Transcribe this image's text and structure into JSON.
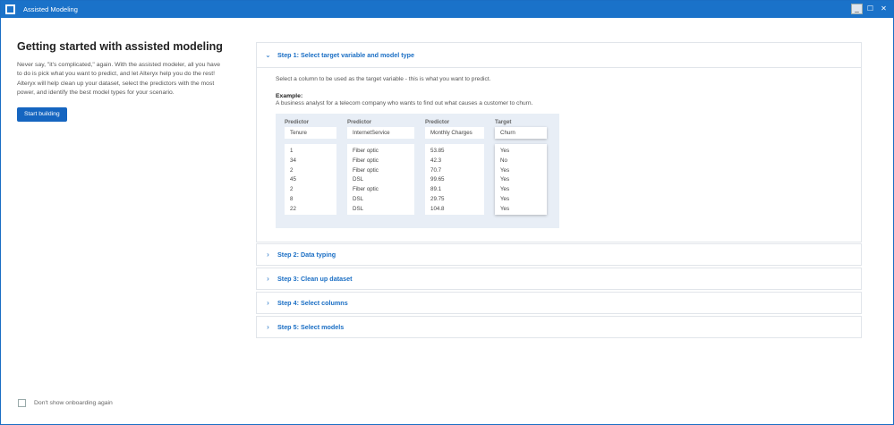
{
  "window": {
    "title": "Assisted Modeling"
  },
  "intro": {
    "heading": "Getting started with assisted modeling",
    "body": "Never say, \"it's complicated,\" again. With the assisted modeler, all you have to do is pick what you want to predict, and let Alteryx help you do the rest! Alteryx will help clean up your dataset, select the predictors with the most power, and identify the best model types for your scenario.",
    "start_button": "Start building"
  },
  "footer": {
    "checkbox_label": "Don't show onboarding again"
  },
  "steps": [
    {
      "title": "Step 1: Select target variable and model type"
    },
    {
      "title": "Step 2: Data typing"
    },
    {
      "title": "Step 3: Clean up dataset"
    },
    {
      "title": "Step 4: Select columns"
    },
    {
      "title": "Step 5: Select models"
    }
  ],
  "step1": {
    "description": "Select a column to be used as the target variable - this is what you want to predict.",
    "example_label": "Example:",
    "example_text": "A business analyst for a telecom company who wants to find out what causes a customer to churn.",
    "columns": [
      {
        "role": "Predictor",
        "name": "Tenure",
        "values": [
          "1",
          "34",
          "2",
          "45",
          "2",
          "8",
          "22"
        ]
      },
      {
        "role": "Predictor",
        "name": "InternetService",
        "values": [
          "Fiber optic",
          "Fiber optic",
          "Fiber optic",
          "DSL",
          "Fiber optic",
          "DSL",
          "DSL"
        ]
      },
      {
        "role": "Predictor",
        "name": "Monthly Charges",
        "values": [
          "53.85",
          "42.3",
          "70.7",
          "99.65",
          "89.1",
          "29.75",
          "104.8"
        ]
      },
      {
        "role": "Target",
        "name": "Churn",
        "values": [
          "Yes",
          "No",
          "Yes",
          "Yes",
          "Yes",
          "Yes",
          "Yes"
        ]
      }
    ]
  }
}
